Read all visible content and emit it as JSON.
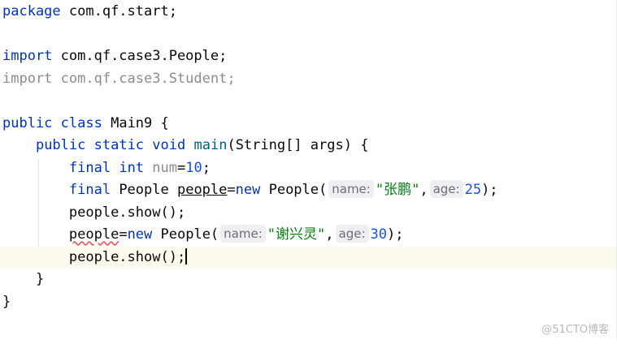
{
  "code": {
    "package_kw": "package",
    "package_name": " com.qf.start;",
    "import_kw": "import",
    "import_people": " com.qf.case3.People;",
    "import_student": "import com.qf.case3.Student;",
    "class_line": {
      "public": "public",
      "class": "class",
      "name": " Main9 {"
    },
    "main_line": {
      "public": "public",
      "static": "static",
      "void": "void",
      "fn": "main",
      "rest": "(String[] args) {"
    },
    "num_line": {
      "final": "final",
      "int": "int",
      "var": "num",
      "eq": "=",
      "val": "10",
      "end": ";"
    },
    "people1_line": {
      "final": "final",
      "type": " People ",
      "var": "people",
      "eq": "=",
      "new": "new",
      "ctor": " People(",
      "hint_name": "name:",
      "str": "\"张鹏\"",
      "comma": ",",
      "hint_age": "age:",
      "val": "25",
      "end": ");"
    },
    "show1_line": "people.show();",
    "people2_line": {
      "var": "people",
      "eq": "=",
      "new": "new",
      "ctor": " People(",
      "hint_name": "name:",
      "str": "\"谢兴灵\"",
      "comma": ",",
      "hint_age": "age:",
      "val": "30",
      "end": ");"
    },
    "show2_line": "people.show();",
    "close_method": "}",
    "close_class": "}"
  },
  "watermark": "@51CTO博客"
}
